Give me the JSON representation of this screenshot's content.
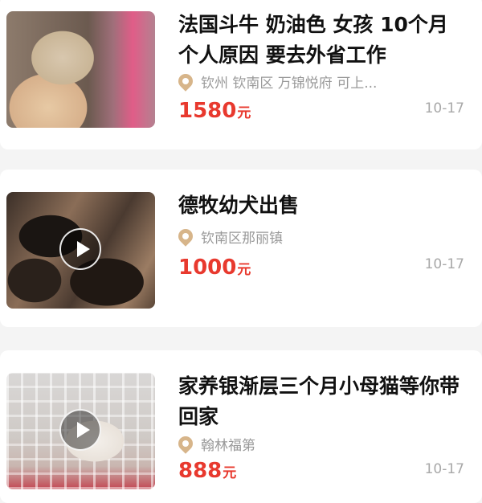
{
  "listings": [
    {
      "title": "法国斗牛 奶油色 女孩 10个月 个人原因 要去外省工作",
      "location": "钦州 钦南区 万锦悦府 可上...",
      "location_icon": "location-pin-icon",
      "price": "1580",
      "currency_unit": "元",
      "date": "10-17",
      "has_video": false
    },
    {
      "title": "德牧幼犬出售",
      "location": "钦南区那丽镇",
      "location_icon": "location-pin-icon",
      "price": "1000",
      "currency_unit": "元",
      "date": "10-17",
      "has_video": true
    },
    {
      "title": "家养银渐层三个月小母猫等你带回家",
      "location": "翰林福第",
      "location_icon": "location-pin-icon",
      "price": "888",
      "currency_unit": "元",
      "date": "10-17",
      "has_video": true
    }
  ],
  "colors": {
    "price": "#e8392e",
    "pin": "#d7b58a",
    "muted_text": "#999999",
    "background": "#f4f4f4"
  }
}
